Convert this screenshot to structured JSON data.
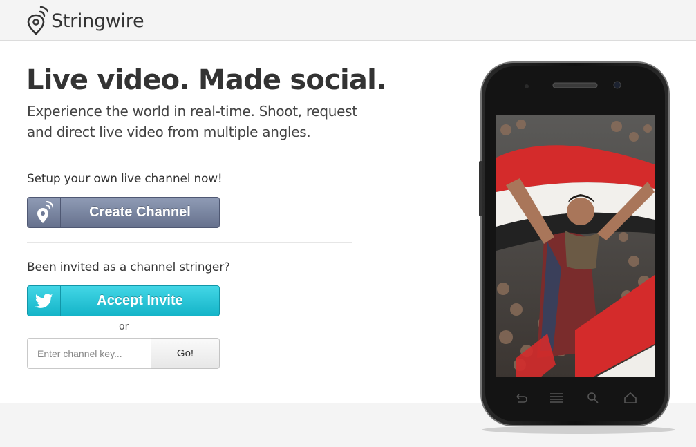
{
  "header": {
    "brand_name": "Stringwire"
  },
  "hero": {
    "title": "Live video. Made social.",
    "subtitle": "Experience the world in real-time. Shoot, request and direct live video from multiple angles."
  },
  "create_section": {
    "prompt": "Setup your own live channel now!",
    "button_label": "Create Channel"
  },
  "invite_section": {
    "prompt": "Been invited as a channel stringer?",
    "button_label": "Accept Invite",
    "or_text": "or",
    "key_placeholder": "Enter channel key...",
    "go_label": "Go!"
  },
  "colors": {
    "create_button": "#6f7a96",
    "accept_button": "#1fc3d5",
    "header_bg": "#f4f4f4",
    "text": "#333333"
  },
  "icons": {
    "logo": "location-pin-signal-icon",
    "create": "location-pin-signal-icon",
    "accept": "twitter-bird-icon"
  }
}
